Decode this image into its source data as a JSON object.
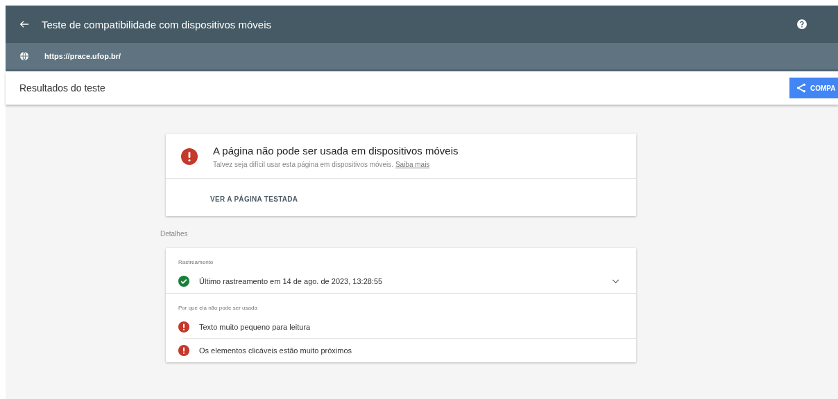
{
  "header": {
    "title": "Teste de compatibilidade com dispositivos móveis",
    "url": "https://prace.ufop.br/"
  },
  "results_bar": {
    "title": "Resultados do teste",
    "share_button": "COMPA"
  },
  "verdict": {
    "title": "A página não pode ser usada em dispositivos móveis",
    "text": "Talvez seja difícil usar esta página em dispositivos móveis.",
    "link": "Saiba mais",
    "action": "VER A PÁGINA TESTADA"
  },
  "details": {
    "heading": "Detalhes",
    "sections": [
      {
        "label": "Rastreamento",
        "items": [
          {
            "kind": "ok",
            "text": "Último rastreamento em 14 de ago. de 2023, 13:28:55",
            "expandable": true
          }
        ]
      },
      {
        "label": "Por que ela não pode ser usada",
        "items": [
          {
            "kind": "error",
            "text": "Texto muito pequeno para leitura",
            "expandable": false
          },
          {
            "kind": "error",
            "text": "Os elementos clicáveis estão muito próximos",
            "expandable": false
          }
        ]
      }
    ]
  }
}
